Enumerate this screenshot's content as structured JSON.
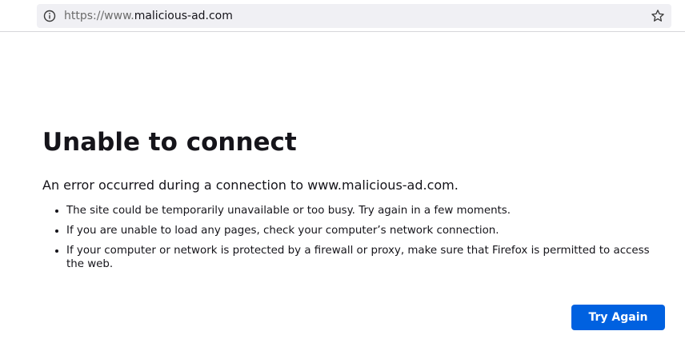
{
  "urlbar": {
    "scheme": "https://www.",
    "host": "malicious-ad.com",
    "info_icon": "info-icon",
    "bookmark_icon": "star-icon"
  },
  "error": {
    "title": "Unable to connect",
    "description": "An error occurred during a connection to www.malicious-ad.com.",
    "reasons": [
      "The site could be temporarily unavailable or too busy. Try again in a few moments.",
      "If you are unable to load any pages, check your computer’s network connection.",
      "If your computer or network is protected by a firewall or proxy, make sure that Firefox is permitted to access the web."
    ],
    "button_label": "Try Again"
  },
  "colors": {
    "accent": "#0061e0",
    "urlbar_bg": "#f0f0f4",
    "text": "#15141a"
  }
}
